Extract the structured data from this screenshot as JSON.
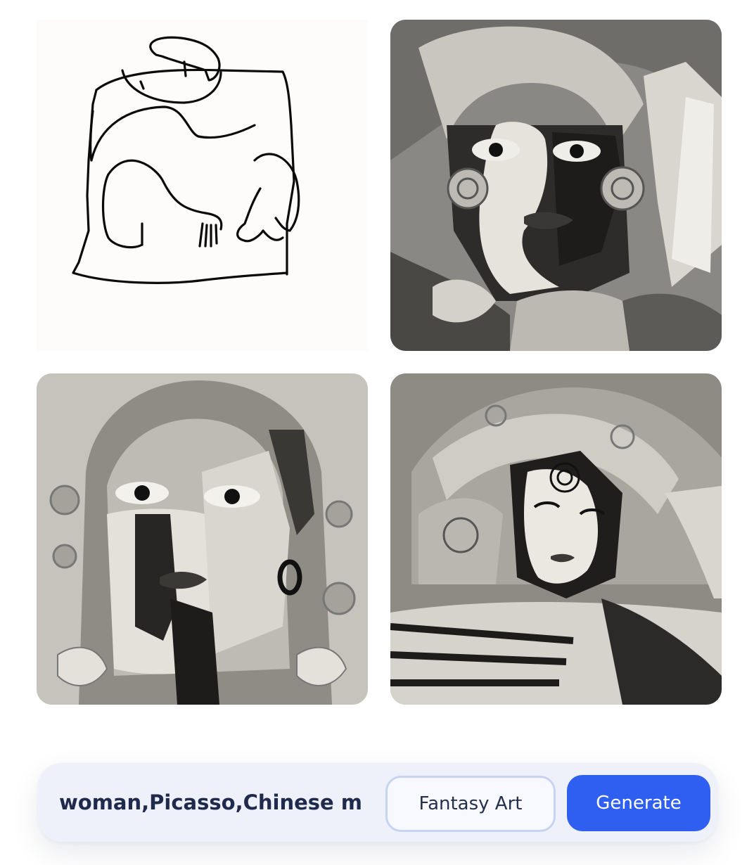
{
  "gallery": {
    "items": [
      {
        "kind": "sketch",
        "icon": "line-sketch-image"
      },
      {
        "kind": "generated",
        "icon": "cubist-portrait-image"
      },
      {
        "kind": "generated",
        "icon": "cubist-portrait-image"
      },
      {
        "kind": "generated",
        "icon": "cubist-portrait-image"
      }
    ]
  },
  "prompt_bar": {
    "prompt_value": "woman,Picasso,Chinese mo",
    "style_label": "Fantasy Art",
    "generate_label": "Generate"
  },
  "colors": {
    "accent": "#2f5ff0",
    "chip_border": "#c7d3f2",
    "bar_background": "#eef1fa"
  }
}
